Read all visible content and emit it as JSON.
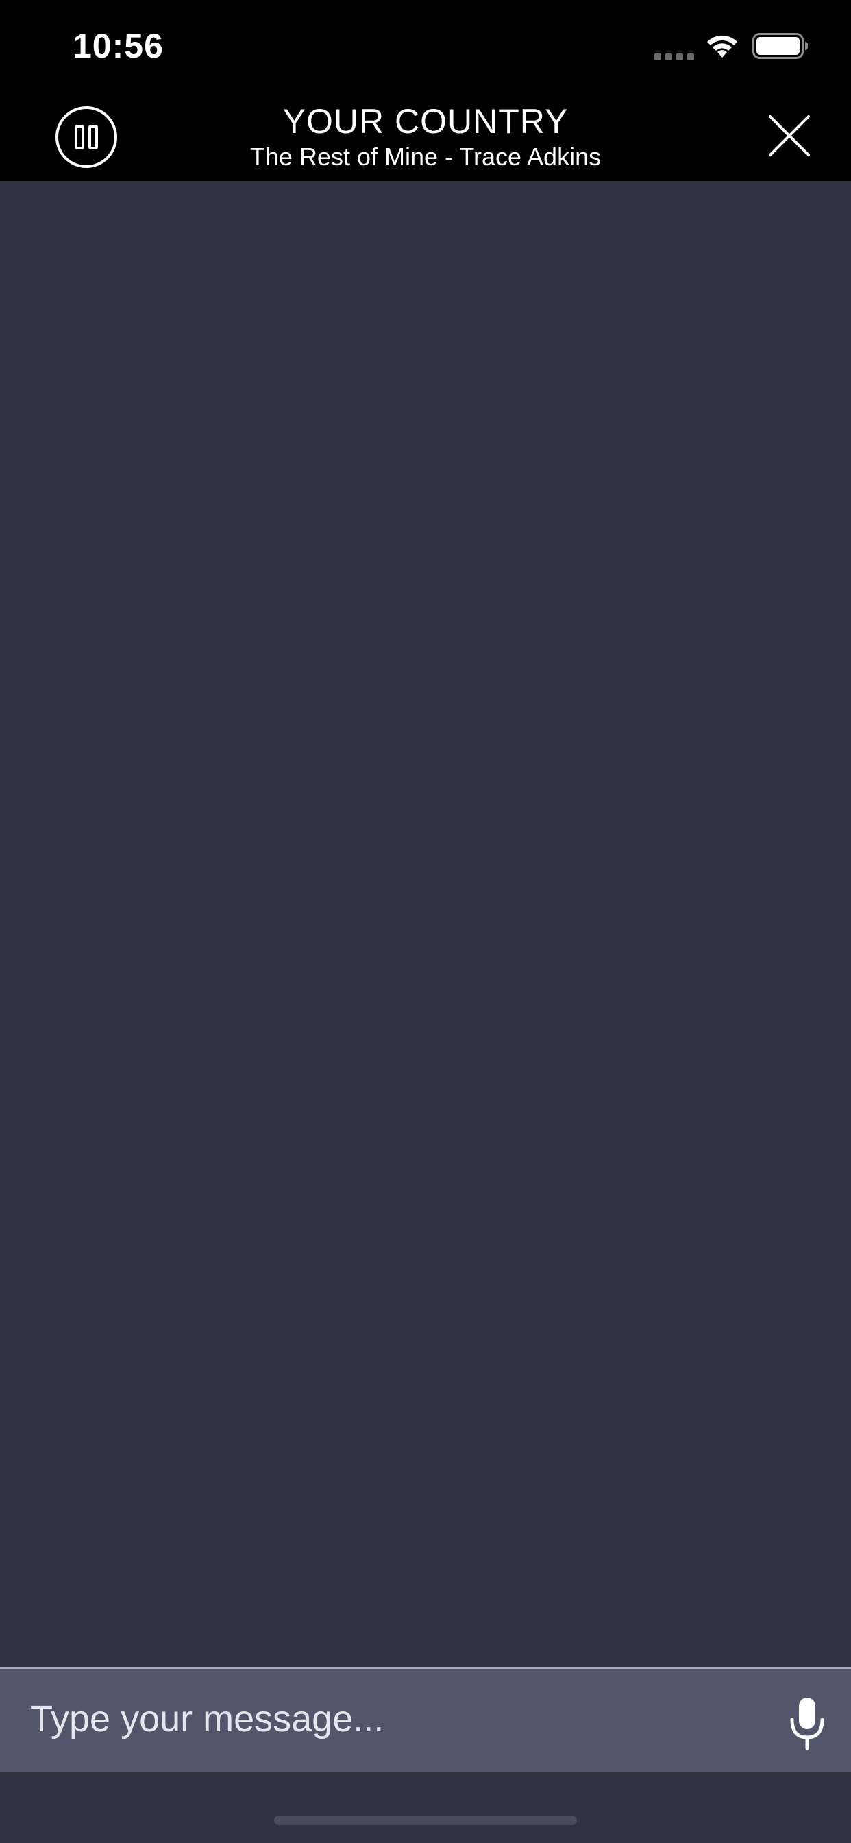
{
  "status_bar": {
    "time": "10:56",
    "icons": [
      "cellular-signal-icon",
      "wifi-icon",
      "battery-icon"
    ]
  },
  "header": {
    "station": "YOUR COUNTRY",
    "now_playing": "The Rest of Mine - Trace Adkins",
    "pause_icon": "pause-circle-icon",
    "close_icon": "close-icon"
  },
  "composer": {
    "placeholder": "Type your message...",
    "value": "",
    "mic_icon": "microphone-icon"
  },
  "colors": {
    "header_bg": "#000000",
    "chat_bg": "#2f3241",
    "input_bg": "#52566a",
    "text": "#ffffff"
  }
}
